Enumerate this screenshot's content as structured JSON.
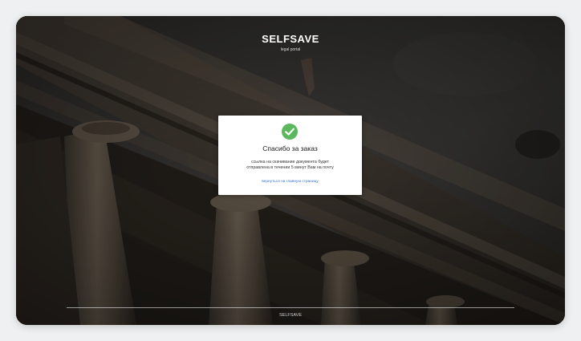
{
  "header": {
    "logo": "SELFSAVE",
    "subtitle": "legal portal"
  },
  "modal": {
    "icon": "check-circle-icon",
    "title": "Спасибо за заказ",
    "message_line1": "ссылка на скачивание документа будет",
    "message_line2": "отправлена в течении 5 минут Вам на почту",
    "link_label": "вернуться на главную страницу"
  },
  "footer": {
    "text": "SELFSAVE"
  },
  "colors": {
    "accent_green": "#5cb85c",
    "link_blue": "#3a78c9",
    "overlay": "#2a2826"
  }
}
